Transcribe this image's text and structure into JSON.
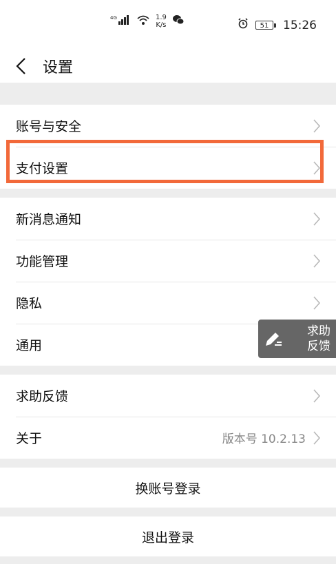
{
  "status_bar": {
    "network": "4G",
    "speed_value": "1.9",
    "speed_unit": "K/s",
    "battery": "51",
    "time": "15:26",
    "icons": [
      "signal-icon",
      "wifi-icon",
      "wechat-icon",
      "alarm-icon",
      "battery-icon"
    ]
  },
  "header": {
    "title": "设置"
  },
  "groups": [
    {
      "items": [
        {
          "label": "账号与安全"
        },
        {
          "label": "支付设置"
        }
      ]
    },
    {
      "items": [
        {
          "label": "新消息通知"
        },
        {
          "label": "功能管理"
        },
        {
          "label": "隐私"
        },
        {
          "label": "通用"
        }
      ]
    },
    {
      "items": [
        {
          "label": "求助反馈"
        },
        {
          "label": "关于",
          "detail": "版本号 10.2.13"
        }
      ]
    }
  ],
  "actions": {
    "switch_account": "换账号登录",
    "logout": "退出登录"
  },
  "floating_feedback": {
    "line1": "求助",
    "line2": "反馈"
  },
  "colors": {
    "highlight": "#f2693a",
    "background": "#ededed",
    "floating_bg": "#666666"
  }
}
